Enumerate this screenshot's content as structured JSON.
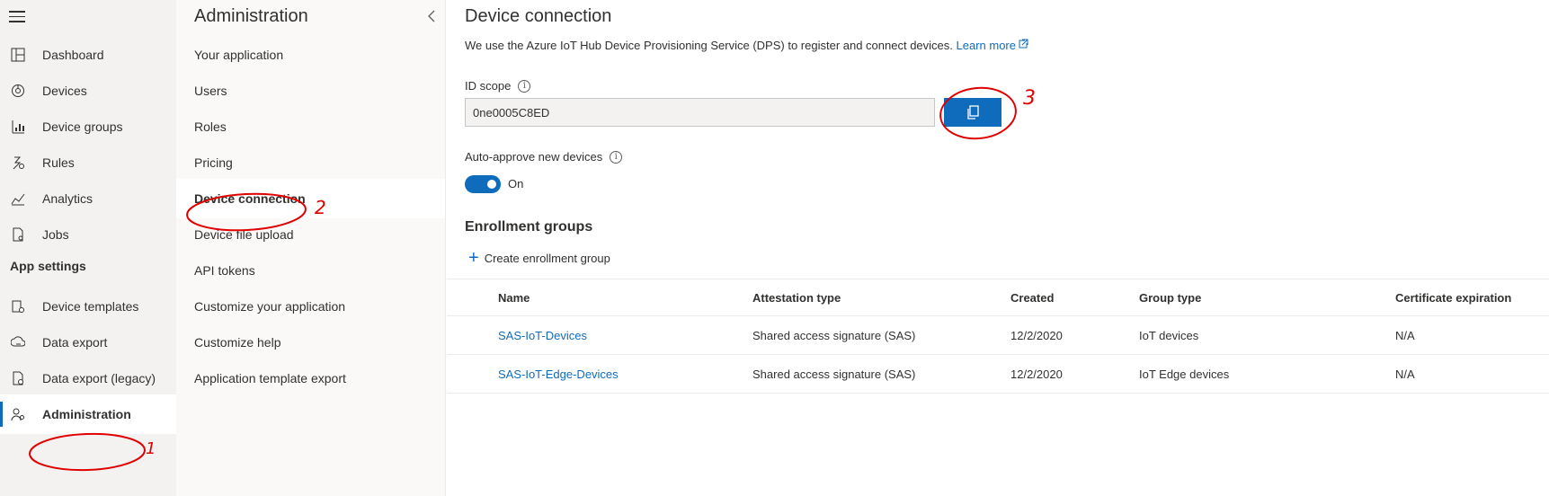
{
  "nav": {
    "items": [
      {
        "label": "Dashboard",
        "icon": "dashboard-icon"
      },
      {
        "label": "Devices",
        "icon": "devices-icon"
      },
      {
        "label": "Device groups",
        "icon": "device-groups-icon"
      },
      {
        "label": "Rules",
        "icon": "rules-icon"
      },
      {
        "label": "Analytics",
        "icon": "analytics-icon"
      },
      {
        "label": "Jobs",
        "icon": "jobs-icon"
      }
    ],
    "section_label": "App settings",
    "settings_items": [
      {
        "label": "Device templates",
        "icon": "device-templates-icon"
      },
      {
        "label": "Data export",
        "icon": "data-export-icon"
      },
      {
        "label": "Data export (legacy)",
        "icon": "data-export-legacy-icon"
      },
      {
        "label": "Administration",
        "icon": "administration-icon",
        "active": true
      }
    ]
  },
  "admin_panel": {
    "title": "Administration",
    "items": [
      "Your application",
      "Users",
      "Roles",
      "Pricing",
      "Device connection",
      "Device file upload",
      "API tokens",
      "Customize your application",
      "Customize help",
      "Application template export"
    ],
    "selected": "Device connection"
  },
  "main": {
    "title": "Device connection",
    "description": "We use the Azure IoT Hub Device Provisioning Service (DPS) to register and connect devices.",
    "learn_more": "Learn more",
    "id_scope_label": "ID scope",
    "id_scope_value": "0ne0005C8ED",
    "auto_approve_label": "Auto-approve new devices",
    "auto_approve_state": "On",
    "enrollment_title": "Enrollment groups",
    "create_label": "Create enrollment group",
    "table": {
      "headers": [
        "Name",
        "Attestation type",
        "Created",
        "Group type",
        "Certificate expiration"
      ],
      "rows": [
        [
          "SAS-IoT-Devices",
          "Shared access signature (SAS)",
          "12/2/2020",
          "IoT devices",
          "N/A"
        ],
        [
          "SAS-IoT-Edge-Devices",
          "Shared access signature (SAS)",
          "12/2/2020",
          "IoT Edge devices",
          "N/A"
        ]
      ]
    }
  },
  "annotations": [
    "1",
    "2",
    "3"
  ],
  "colors": {
    "accent": "#0f6cbd",
    "annotation": "#e00000"
  }
}
